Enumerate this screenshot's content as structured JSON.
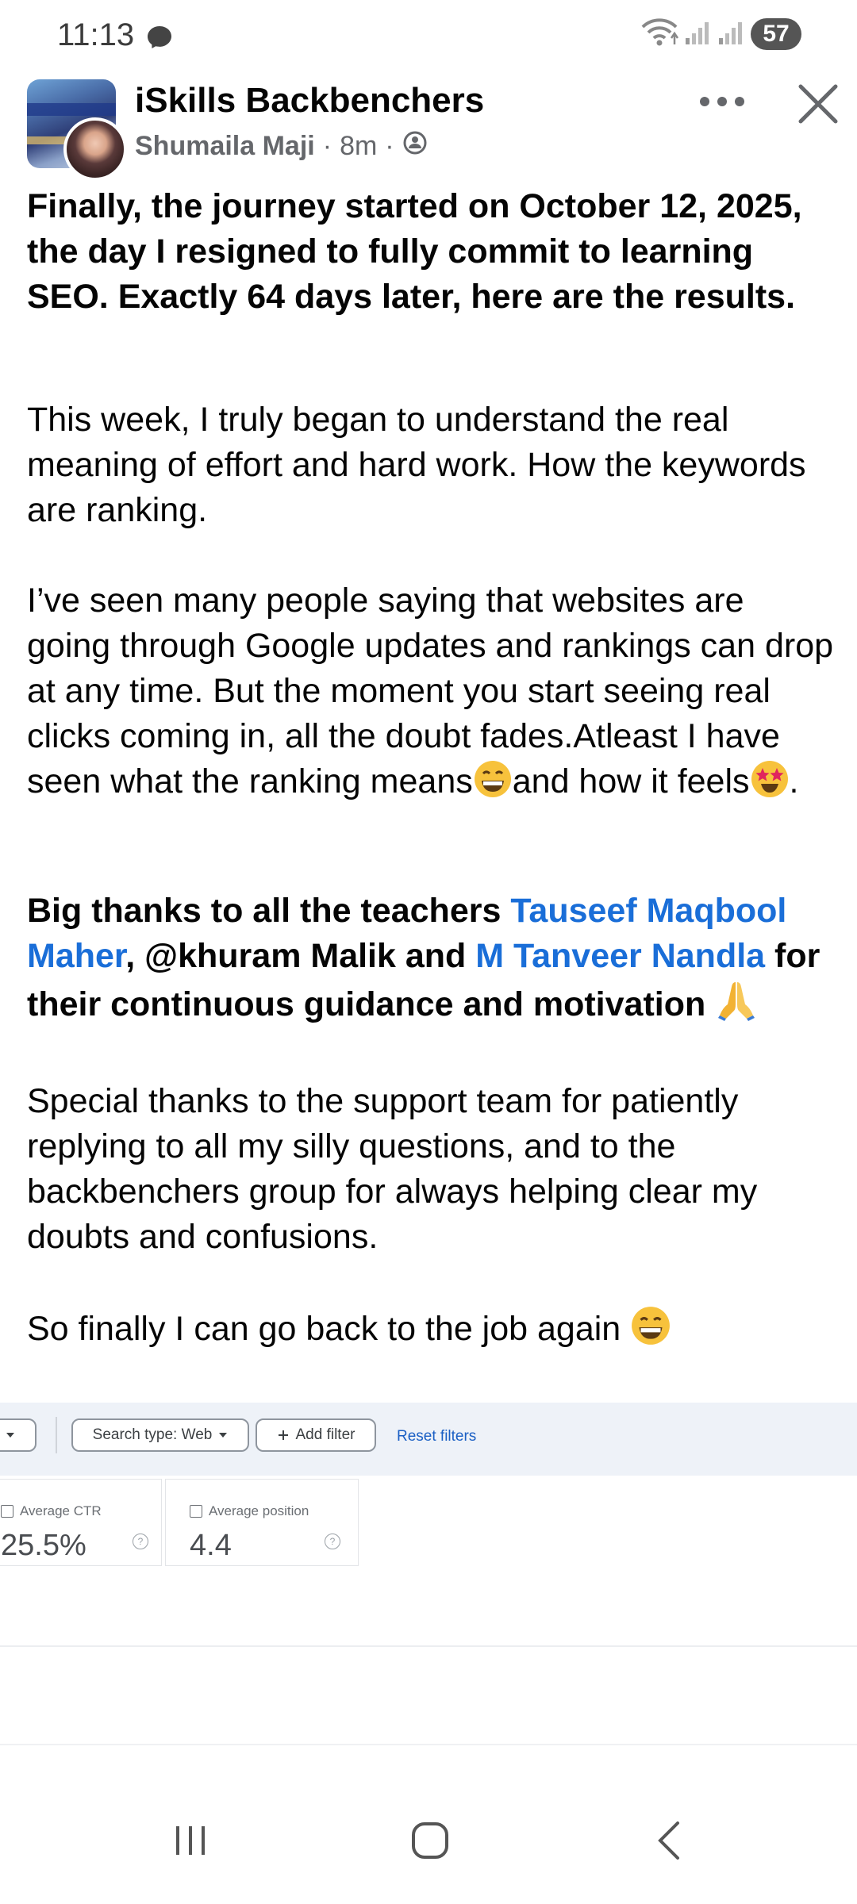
{
  "status_bar": {
    "time": "11:13",
    "battery": "57",
    "icons": [
      "messenger-icon",
      "wifi-icon",
      "signal-icon",
      "signal-icon"
    ]
  },
  "post": {
    "group_name": "iSkills Backbenchers",
    "author": "Shumaila Maji",
    "separator": "·",
    "time_ago": "8m",
    "privacy_icon": "members-only-icon",
    "paragraphs": {
      "headline": "Finally, the journey started on October 12, 2025, the day I resigned to fully commit to learning SEO. Exactly 64 days later, here are the results.",
      "p1": "This week, I truly began to understand the real meaning of effort and hard work. How the keywords are ranking.",
      "p2_a": "I’ve seen many people saying that websites are going through Google updates and rankings can drop at any time. But the moment you start seeing real clicks coming in, all the doubt fades.Atleast I have seen what the ranking means",
      "p2_b": "and how it feels",
      "p2_c": ".",
      "thanks_a": "Big thanks to all the teachers ",
      "mention_1": "Tauseef Maqbool Maher",
      "thanks_b": ", @khuram Malik and  ",
      "mention_2": "M Tanveer Nandla",
      "thanks_c": " for their continuous guidance and motivation ",
      "p4": "Special thanks to the support team for patiently replying to all my silly questions, and to the backbenchers group for always helping clear my doubts and confusions.",
      "p5": "So finally I can go back to the job again "
    },
    "emojis": [
      "grinning-face-emoji",
      "star-struck-emoji",
      "folded-hands-emoji",
      "grinning-face-emoji"
    ]
  },
  "search_console": {
    "search_type_chip": "Search type: Web",
    "add_filter": "Add filter",
    "reset_filters": "Reset filters",
    "metrics": [
      {
        "label": "Average CTR",
        "value": "25.5%"
      },
      {
        "label": "Average position",
        "value": "4.4"
      }
    ],
    "help_glyph": "?"
  },
  "nav_bar": {
    "icons": [
      "recent-apps-icon",
      "home-icon",
      "back-icon"
    ]
  },
  "colors": {
    "mention": "#1a6ed8",
    "secondary_text": "#65676b",
    "link": "#1a5fc4"
  }
}
